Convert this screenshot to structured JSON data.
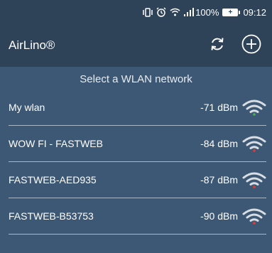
{
  "status_bar": {
    "signal_percent": "100%",
    "battery_label": "+",
    "time": "09:12",
    "icons": [
      "vibrate-icon",
      "alarm-icon",
      "wifi-status-icon",
      "cell-signal-icon",
      "battery-icon"
    ]
  },
  "app_bar": {
    "title": "AirLino®",
    "refresh_icon": "refresh-icon",
    "add_icon": "add-circle-icon"
  },
  "subheader": "Select a WLAN network",
  "networks": [
    {
      "ssid": "My wlan",
      "signal": "-71 dBm",
      "dot_color": "#4caf50"
    },
    {
      "ssid": "WOW FI - FASTWEB",
      "signal": "-84 dBm",
      "dot_color": "#e53935"
    },
    {
      "ssid": "FASTWEB-AED935",
      "signal": "-87 dBm",
      "dot_color": "#e53935"
    },
    {
      "ssid": "FASTWEB-B53753",
      "signal": "-90 dBm",
      "dot_color": "#e53935"
    }
  ],
  "colors": {
    "background": "#3d5874",
    "app_bar": "#2f4358",
    "divider": "#a9b6c4",
    "wifi_arc": "#d9dee4"
  }
}
